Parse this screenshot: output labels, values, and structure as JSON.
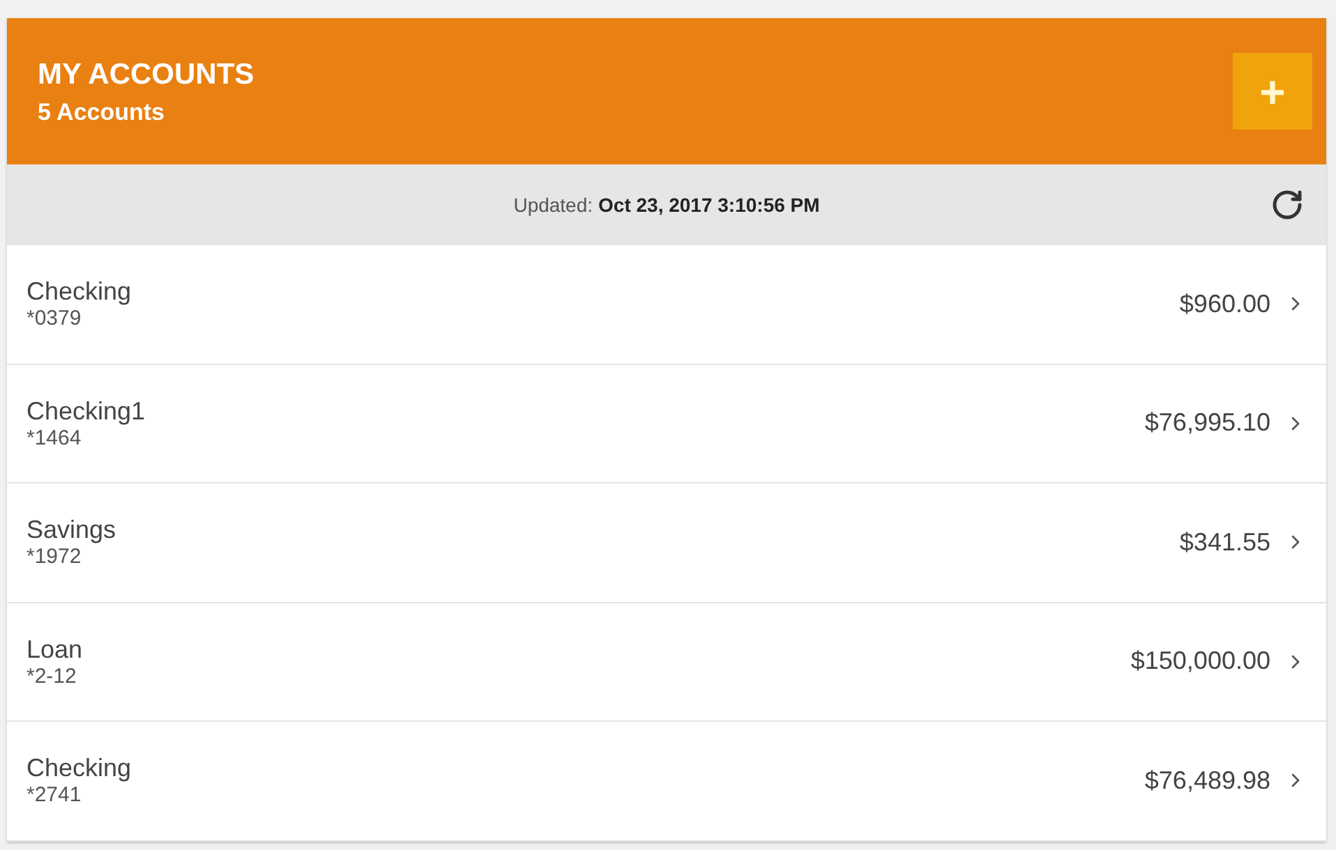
{
  "header": {
    "title": "MY ACCOUNTS",
    "subtitle": "5 Accounts",
    "add_button": "+"
  },
  "updated": {
    "label": "Updated:",
    "value": "Oct 23, 2017 3:10:56 PM"
  },
  "accounts": [
    {
      "name": "Checking",
      "number": "*0379",
      "balance": "$960.00"
    },
    {
      "name": "Checking1",
      "number": "*1464",
      "balance": "$76,995.10"
    },
    {
      "name": "Savings",
      "number": "*1972",
      "balance": "$341.55"
    },
    {
      "name": "Loan",
      "number": "*2-12",
      "balance": "$150,000.00"
    },
    {
      "name": "Checking",
      "number": "*2741",
      "balance": "$76,489.98"
    }
  ]
}
